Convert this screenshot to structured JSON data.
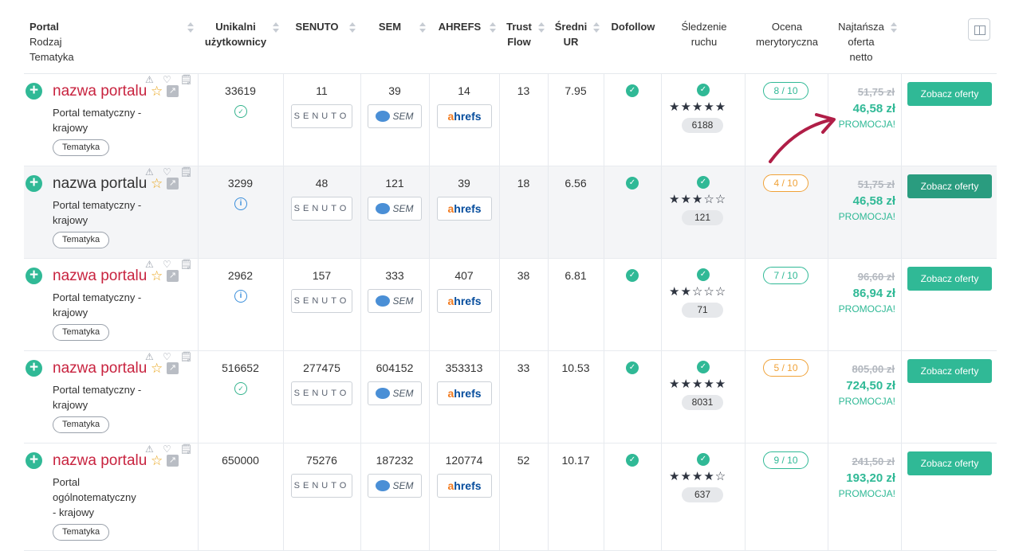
{
  "header": {
    "portal": [
      "Portal",
      "Rodzaj",
      "Tematyka"
    ],
    "users": [
      "Unikalni",
      "użytkownicy"
    ],
    "senuto": "SENUTO",
    "sem": "SEM",
    "ahrefs": "AHREFS",
    "trust": [
      "Trust",
      "Flow"
    ],
    "ur": [
      "Średni",
      "UR"
    ],
    "dofollow": "Dofollow",
    "traffic": [
      "Śledzenie",
      "ruchu"
    ],
    "rating": [
      "Ocena",
      "merytoryczna"
    ],
    "offer": [
      "Najtańsza",
      "oferta",
      "netto"
    ]
  },
  "logos": {
    "senuto": "SENUTO",
    "sem": "SEM",
    "ahrefs_a": "a",
    "ahrefs_rest": "hrefs"
  },
  "colors": {
    "accent": "#30b996",
    "portal_name": "#c8233f",
    "orange": "#f0a238",
    "arrow": "#b01e47"
  },
  "rows": [
    {
      "name": "nazwa portalu",
      "type": "Portal tematyczny -\nkrajowy",
      "tag": "Tematyka",
      "users": "33619",
      "verify": "check",
      "senuto": "11",
      "sem": "39",
      "ahrefs": "14",
      "trust": "13",
      "ur": "7.95",
      "stars": "★★★★★",
      "stars_count": 5,
      "traffic": "6188",
      "score": "8 / 10",
      "score_color": "green",
      "old": "51,75 zł",
      "new": "46,58 zł",
      "promo": "PROMOCJA!",
      "button": "Zobacz oferty"
    },
    {
      "name": "nazwa portalu",
      "type": "Portal tematyczny -\nkrajowy",
      "tag": "Tematyka",
      "users": "3299",
      "verify": "info",
      "senuto": "48",
      "sem": "121",
      "ahrefs": "39",
      "trust": "18",
      "ur": "6.56",
      "stars": "★★★☆☆",
      "stars_count": 3,
      "traffic": "121",
      "score": "4 / 10",
      "score_color": "orange",
      "old": "51,75 zł",
      "new": "46,58 zł",
      "promo": "PROMOCJA!",
      "button": "Zobacz oferty"
    },
    {
      "name": "nazwa portalu",
      "type": "Portal tematyczny -\nkrajowy",
      "tag": "Tematyka",
      "users": "2962",
      "verify": "info",
      "senuto": "157",
      "sem": "333",
      "ahrefs": "407",
      "trust": "38",
      "ur": "6.81",
      "stars": "★★☆☆☆",
      "stars_count": 2,
      "traffic": "71",
      "score": "7 / 10",
      "score_color": "green",
      "old": "96,60 zł",
      "new": "86,94 zł",
      "promo": "PROMOCJA!",
      "button": "Zobacz oferty"
    },
    {
      "name": "nazwa portalu",
      "type": "Portal tematyczny -\nkrajowy",
      "tag": "Tematyka",
      "users": "516652",
      "verify": "check",
      "senuto": "277475",
      "sem": "604152",
      "ahrefs": "353313",
      "trust": "33",
      "ur": "10.53",
      "stars": "★★★★★",
      "stars_count": 5,
      "traffic": "8031",
      "score": "5 / 10",
      "score_color": "orange",
      "old": "805,00 zł",
      "new": "724,50 zł",
      "promo": "PROMOCJA!",
      "button": "Zobacz oferty"
    },
    {
      "name": "nazwa portalu",
      "type": "Portal\nogólnotematyczny\n- krajowy",
      "tag": "Tematyka",
      "users": "650000",
      "verify": "none",
      "senuto": "75276",
      "sem": "187232",
      "ahrefs": "120774",
      "trust": "52",
      "ur": "10.17",
      "stars": "★★★★☆",
      "stars_count": 4,
      "traffic": "637",
      "score": "9 / 10",
      "score_color": "green",
      "old": "241,50 zł",
      "new": "193,20 zł",
      "promo": "PROMOCJA!",
      "button": "Zobacz oferty"
    }
  ]
}
